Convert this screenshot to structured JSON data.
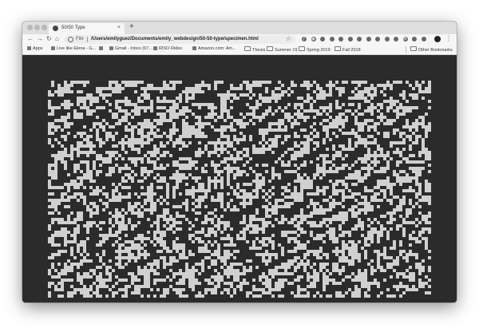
{
  "tab": {
    "title": "50/50 Type",
    "close": "×",
    "new_tab": "+"
  },
  "toolbar": {
    "back": "←",
    "forward": "→",
    "reload": "↻",
    "home": "⌂",
    "scheme": "File",
    "url": "/Users/emilyguez/Documents/emily_webdesign/50-50-type/specimen.html",
    "star": "☆",
    "menu": "⋮"
  },
  "extensions": [
    "ƒ",
    "◉",
    "",
    "",
    "",
    "",
    "",
    "",
    "",
    "",
    "",
    "M",
    "",
    ""
  ],
  "bookmarks": [
    {
      "label": "Apps"
    },
    {
      "label": "Live like Elena - G..."
    },
    {
      "label": ""
    },
    {
      "label": "Gmail - Inbox (67..."
    },
    {
      "label": "RISO Rides"
    },
    {
      "label": "Amazon.com: Am..."
    },
    {
      "label": "Thesis"
    },
    {
      "label": "Summer 19"
    },
    {
      "label": "Spring 2019"
    },
    {
      "label": "Fall 2018"
    }
  ],
  "other_bookmarks": "Other Bookmarks",
  "colors": {
    "page_bg": "#2b2b2b",
    "glyph": "#d0d0d0"
  }
}
